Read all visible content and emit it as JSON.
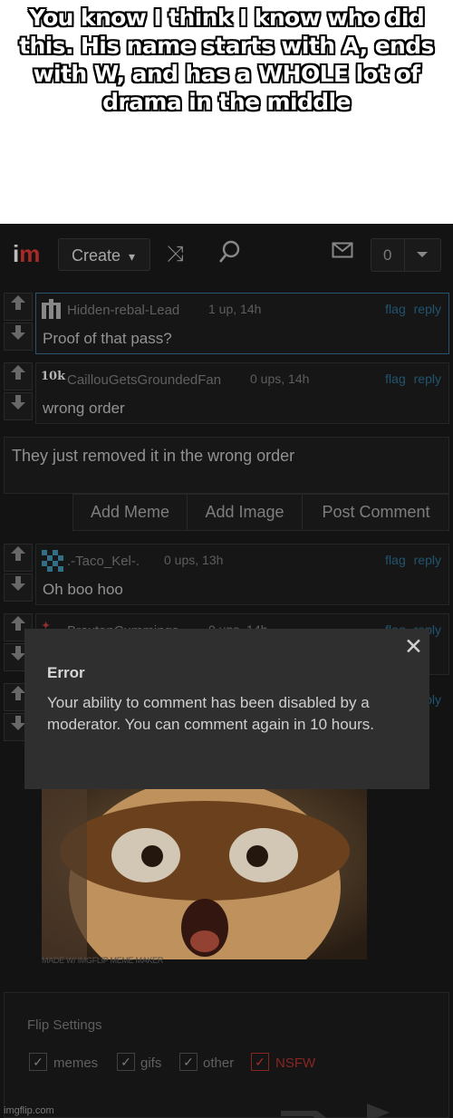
{
  "caption": "You know I think I know who did this. His name starts with A, ends with W, and has a WHOLE lot of drama in the middle",
  "topbar": {
    "logo_i": "i",
    "logo_m": "m",
    "create_label": "Create",
    "caret": "▾",
    "shuffle_icon": "⤨",
    "search_icon": "⚲",
    "mail_icon": "✉",
    "notif_count": "0"
  },
  "comments": [
    {
      "username": "Hidden-rebal-Lead",
      "meta": "1 up, 14h",
      "text": "Proof of that pass?",
      "flag": "flag",
      "reply": "reply"
    },
    {
      "username": "CaillouGetsGroundedFan",
      "badge": "10k",
      "meta": "0 ups, 14h",
      "text": "wrong order",
      "flag": "flag",
      "reply": "reply"
    },
    {
      "username": ".-Taco_Kel-.",
      "meta": "0 ups, 13h",
      "text": "Oh boo hoo",
      "flag": "flag",
      "reply": "reply"
    },
    {
      "username": "BraxtonCummings",
      "meta": "0 ups, 14h",
      "flag": "flag",
      "reply": "reply"
    },
    {
      "reply": "reply"
    }
  ],
  "compose": {
    "text": "They just removed it in the wrong order",
    "add_meme": "Add Meme",
    "add_image": "Add Image",
    "post_comment": "Post Comment"
  },
  "dialog": {
    "title": "Error",
    "message": "Your ability to comment has been disabled by a moderator. You can comment again in 10 hours.",
    "close": "✕"
  },
  "meme": {
    "caption": "MADE W/ IMGFLIP MEME MAKER"
  },
  "settings": {
    "title": "Flip Settings",
    "options": [
      {
        "label": "memes",
        "checked": true
      },
      {
        "label": "gifs",
        "checked": true
      },
      {
        "label": "other",
        "checked": true
      },
      {
        "label": "NSFW",
        "checked": true
      }
    ]
  },
  "watermark": "imgflip.com",
  "colors": {
    "accent_red": "#c0302b",
    "link_blue": "#25607f",
    "nsfw_red": "#9c2a2a"
  }
}
